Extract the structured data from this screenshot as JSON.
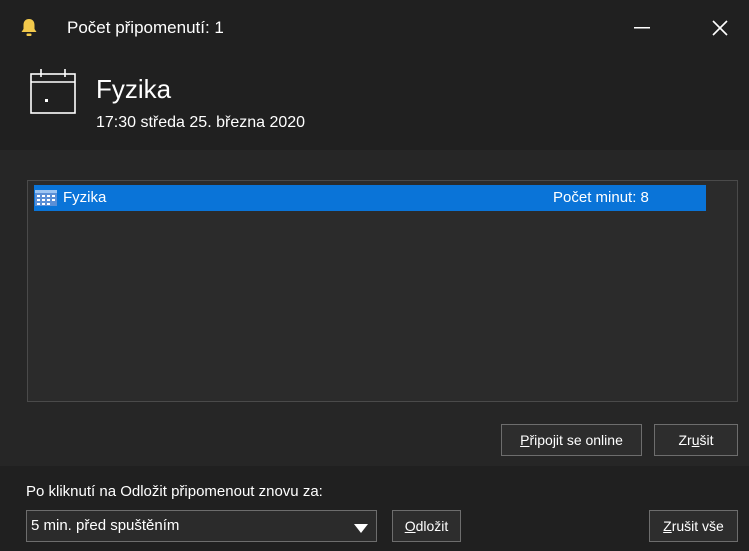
{
  "window": {
    "title": "Počet připomenutí: 1",
    "minimize_label": "—",
    "close_label": "✕"
  },
  "event": {
    "title": "Fyzika",
    "time": "17:30 středa 25. března 2020"
  },
  "reminders": [
    {
      "subject": "Fyzika",
      "due": "Počet minut: 8"
    }
  ],
  "buttons": {
    "join_prefix": "",
    "join_accel": "P",
    "join_rest": "řipojit se online",
    "dismiss_prefix": "Zr",
    "dismiss_accel": "u",
    "dismiss_rest": "šit",
    "snooze_prefix": "",
    "snooze_accel": "O",
    "snooze_rest": "dložit",
    "dismiss_all_prefix": "",
    "dismiss_all_accel": "Z",
    "dismiss_all_rest": "rušit vše"
  },
  "snooze": {
    "label": "Po kliknutí na Odložit připomenout znovu za:",
    "selected": "5 min. před spuštěním"
  },
  "colors": {
    "accent": "#0a74d8",
    "bell": "#f2c94c"
  },
  "icons": {
    "bell": "bell-icon",
    "calendar": "calendar-icon",
    "appointment": "appointment-icon"
  }
}
